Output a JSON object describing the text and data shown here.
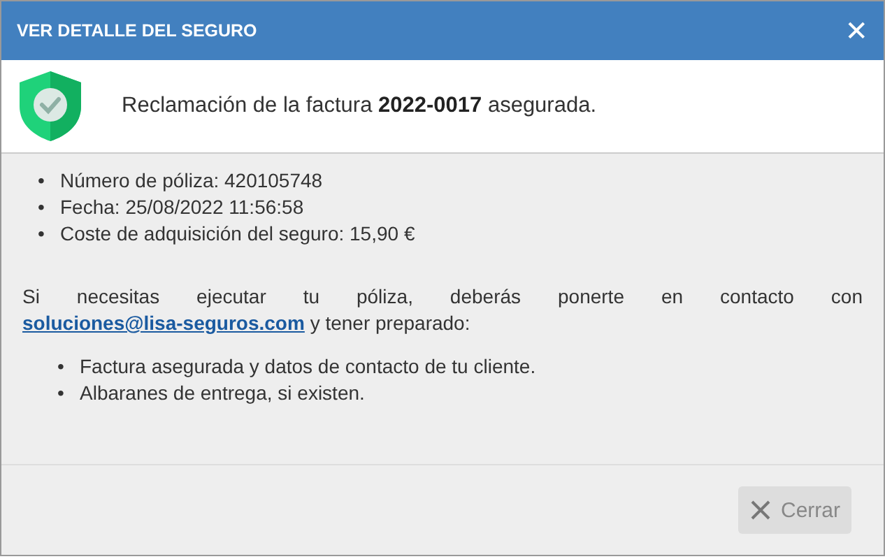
{
  "window": {
    "title": "VER DETALLE DEL SEGURO",
    "close": "✕"
  },
  "header": {
    "message": "Reclamación de la factura **2022-0017** asegurada."
  },
  "details": [
    {
      "bullet": "•",
      "text": "Número de póliza: 420105748"
    },
    {
      "bullet": "•",
      "text": "Fecha: 25/08/2022 11:56:58"
    },
    {
      "bullet": "•",
      "text": "Coste de adquisición del seguro: 15,90 €"
    }
  ],
  "contact": {
    "text_before": "Si necesitas ejecutar tu póliza, deberás ponerte en contacto con ",
    "link": "soluciones@lisa-seguros.com",
    "text_after": " y tener preparado:"
  },
  "requirements": [
    {
      "bullet": "•",
      "text": "Factura asegurada y datos de contacto de tu cliente."
    },
    {
      "bullet": "•",
      "text": "Albaranes de entrega, si existen."
    }
  ],
  "footer": {
    "button": {
      "label": "Cerrar",
      "disabled": true
    }
  }
}
